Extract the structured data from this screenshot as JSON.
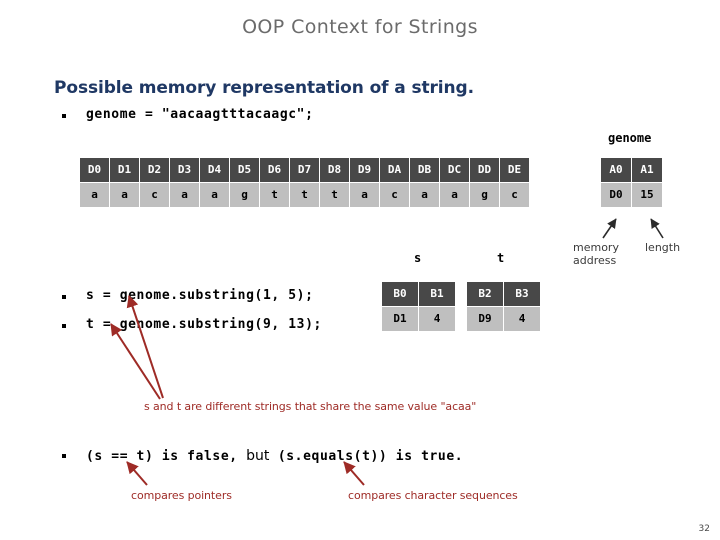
{
  "slide": {
    "title": "OOP Context for Strings",
    "page_number": "32",
    "section_heading": "Possible memory representation of a string.",
    "title_color": "#6b6b6b",
    "heading_color": "#1f3864",
    "annotation_color": "#9e2b26",
    "cell_header_bg": "#484848",
    "cell_value_bg": "#bfbfbf"
  },
  "code_lines": {
    "declaration": "genome = \"aacaagtttacaagc\";",
    "s_assign": "s = genome.substring(1, 5);",
    "t_assign": "t = genome.substring(9, 13);"
  },
  "memory_strip": {
    "label": "",
    "addresses": [
      "D0",
      "D1",
      "D2",
      "D3",
      "D4",
      "D5",
      "D6",
      "D7",
      "D8",
      "D9",
      "DA",
      "DB",
      "DC",
      "DD",
      "DE"
    ],
    "values": [
      "a",
      "a",
      "c",
      "a",
      "a",
      "g",
      "t",
      "t",
      "t",
      "a",
      "c",
      "a",
      "a",
      "g",
      "c"
    ]
  },
  "genome_object": {
    "title": "genome",
    "addresses": [
      "A0",
      "A1"
    ],
    "values": [
      "D0",
      "15"
    ],
    "field_labels": {
      "memory_address_line1": "memory",
      "memory_address_line2": "address",
      "length": "length"
    }
  },
  "s_object": {
    "title": "s",
    "addresses": [
      "B0",
      "B1"
    ],
    "values": [
      "D1",
      "4"
    ]
  },
  "t_object": {
    "title": "t",
    "addresses": [
      "B2",
      "B3"
    ],
    "values": [
      "D9",
      "4"
    ]
  },
  "annotations": {
    "share_value": "s and t are different strings that share the same value \"acaa\"",
    "compares_pointers": "compares pointers",
    "compares_sequences": "compares character sequences"
  },
  "comparison_line": {
    "part1": "(s == t) is false,",
    "part2": "but",
    "part3": "(s.equals(t)) is true."
  },
  "icons": {
    "bullet": "square-bullet-icon",
    "pointer_arrow": "arrow-icon"
  }
}
